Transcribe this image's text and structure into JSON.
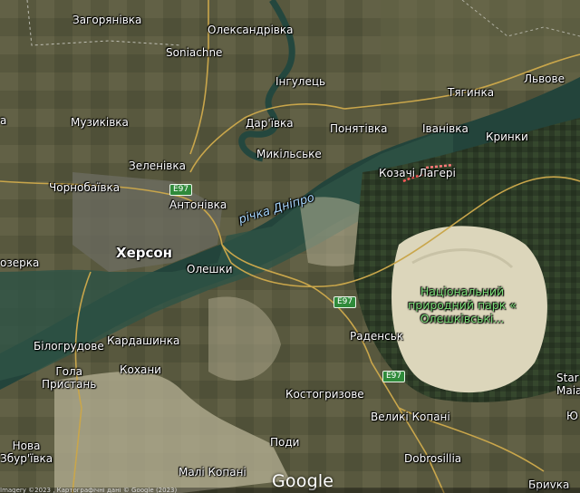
{
  "map": {
    "type": "satellite",
    "places": [
      {
        "id": "zahoriankivka",
        "name": "Загорянівка"
      },
      {
        "id": "oleksandrivka",
        "name": "Олександрівка"
      },
      {
        "id": "soniachne",
        "name": "Soniachne"
      },
      {
        "id": "inhulets",
        "name": "Інгулець"
      },
      {
        "id": "lvove",
        "name": "Львове"
      },
      {
        "id": "tiahynka",
        "name": "Тягинка"
      },
      {
        "id": "muzykivka",
        "name": "Музиківка"
      },
      {
        "id": "darivka",
        "name": "Дар'ївка"
      },
      {
        "id": "ponyativka",
        "name": "Понятівка"
      },
      {
        "id": "ivanivka",
        "name": "Іванівка"
      },
      {
        "id": "krynky",
        "name": "Кринки"
      },
      {
        "id": "mykilske",
        "name": "Микільське"
      },
      {
        "id": "zelenivka",
        "name": "Зеленівка"
      },
      {
        "id": "chornobaivka",
        "name": "Чорнобаївка"
      },
      {
        "id": "antonivka",
        "name": "Антонівка"
      },
      {
        "id": "kozachi_laheri",
        "name": "Козачі Лагері"
      },
      {
        "id": "kherson",
        "name": "Херсон"
      },
      {
        "id": "ozerka",
        "name": "озерка"
      },
      {
        "id": "oleshky",
        "name": "Олешки"
      },
      {
        "id": "bilohrudove",
        "name": "Білогрудове"
      },
      {
        "id": "kardashynka",
        "name": "Кардашинка"
      },
      {
        "id": "radensk",
        "name": "Раденськ"
      },
      {
        "id": "hola_prystan",
        "name": "Гола\nПристань"
      },
      {
        "id": "kokhany",
        "name": "Кохани"
      },
      {
        "id": "kostohryzove",
        "name": "Костогризове"
      },
      {
        "id": "velyki_kopani",
        "name": "Великі Копані"
      },
      {
        "id": "nova_zburivka",
        "name": "Нова\nЗбур'ївка"
      },
      {
        "id": "pody",
        "name": "Поди"
      },
      {
        "id": "dobrosillia",
        "name": "Dobrosillia"
      },
      {
        "id": "mali_kopani",
        "name": "Малі Копані"
      },
      {
        "id": "bryvka",
        "name": "Бриvка"
      },
      {
        "id": "a_left",
        "name": "а"
      },
      {
        "id": "star_maias",
        "name": "Star\nMaias"
      },
      {
        "id": "yu_right",
        "name": "Ю"
      }
    ],
    "water_label": "річка Дніпро",
    "park_label": "Національний природний парк « Олешківські...",
    "road_shields": [
      {
        "id": "e97_1",
        "text": "E97"
      },
      {
        "id": "e97_2",
        "text": "E97"
      },
      {
        "id": "e97_3",
        "text": "E97"
      }
    ],
    "logo": "Google",
    "copyright": "Imagery ©2023 , Картографічні дані © Google (2023)"
  },
  "colors": {
    "fields": "#57573d",
    "fields_light": "#6b6a4a",
    "forest": "#2b3a24",
    "river": "#1d3a34",
    "river_light": "#2d5a4a",
    "sand": "#d8d2b8",
    "road": "#c9a64b"
  }
}
